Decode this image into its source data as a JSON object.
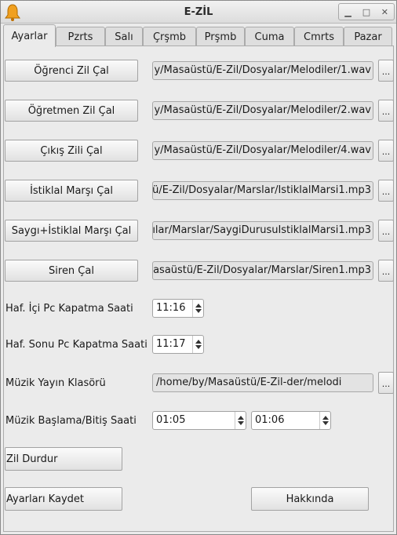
{
  "window": {
    "title": "E-ZİL"
  },
  "tabs": [
    "Ayarlar",
    "Pzrts",
    "Salı",
    "Çrşmb",
    "Prşmb",
    "Cuma",
    "Cmrts",
    "Pazar"
  ],
  "rows": [
    {
      "button": "Öğrenci Zil Çal",
      "path": "y/Masaüstü/E-Zil/Dosyalar/Melodiler/1.wav"
    },
    {
      "button": "Öğretmen Zil Çal",
      "path": "y/Masaüstü/E-Zil/Dosyalar/Melodiler/2.wav"
    },
    {
      "button": "Çıkış Zili Çal",
      "path": "y/Masaüstü/E-Zil/Dosyalar/Melodiler/4.wav"
    },
    {
      "button": "İstiklal Marşı Çal",
      "path": "ü/E-Zil/Dosyalar/Marslar/IstiklalMarsi1.mp3"
    },
    {
      "button": "Saygı+İstiklal Marşı Çal",
      "path": "ılar/Marslar/SaygiDurusuIstiklalMarsi1.mp3"
    },
    {
      "button": "Siren Çal",
      "path": "asaüstü/E-Zil/Dosyalar/Marslar/Siren1.mp3"
    }
  ],
  "browse_label": "...",
  "weekday_shutdown": {
    "label": "Haf. İçi Pc Kapatma Saati",
    "value": "11:16"
  },
  "weekend_shutdown": {
    "label": "Haf. Sonu Pc Kapatma Saati",
    "value": "11:17"
  },
  "music_folder": {
    "label": "Müzik Yayın Klasörü",
    "value": "/home/by/Masaüstü/E-Zil-der/melodi"
  },
  "music_time": {
    "label": "Müzik Başlama/Bitiş Saati",
    "start": "01:05",
    "end": "01:06"
  },
  "stop_button": "Zil Durdur",
  "save_button": "Ayarları Kaydet",
  "about_button": "Hakkında"
}
